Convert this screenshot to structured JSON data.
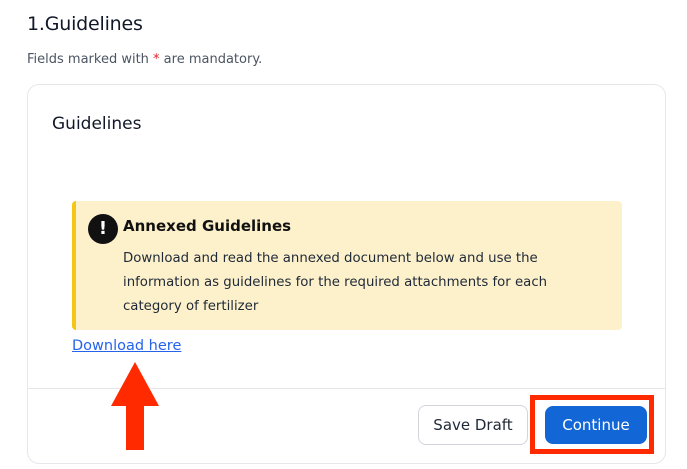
{
  "header": {
    "step_title": "1.Guidelines",
    "mandatory_prefix": "Fields marked with ",
    "mandatory_star": "*",
    "mandatory_suffix": " are mandatory."
  },
  "card": {
    "title": "Guidelines",
    "alert": {
      "icon": "exclamation-icon",
      "icon_glyph": "!",
      "title": "Annexed Guidelines",
      "body": "Download and read the annexed document below and use the information as guidelines for the required attachments for each category of fertilizer"
    },
    "download_link": "Download here"
  },
  "footer": {
    "save_draft_label": "Save Draft",
    "continue_label": "Continue"
  },
  "colors": {
    "primary": "#1366d6",
    "alert_bg": "#fdf1cc",
    "alert_border": "#f5c518",
    "annotation_red": "#ff2a00",
    "link": "#2563eb"
  }
}
